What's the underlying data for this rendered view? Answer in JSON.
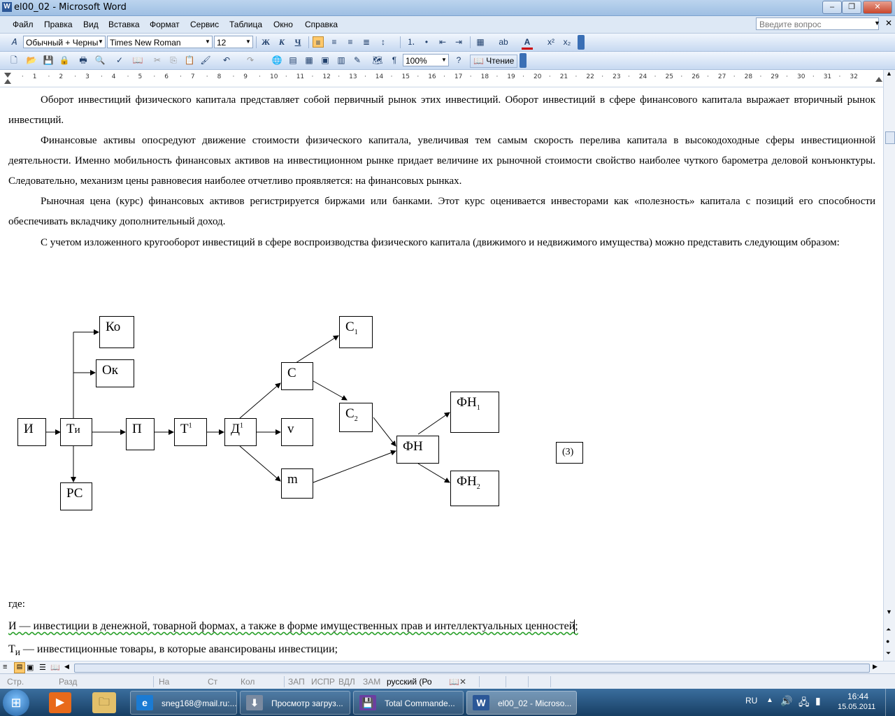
{
  "window": {
    "title": "el00_02 - Microsoft Word"
  },
  "menu": [
    "Файл",
    "Правка",
    "Вид",
    "Вставка",
    "Формат",
    "Сервис",
    "Таблица",
    "Окно",
    "Справка"
  ],
  "helpbox": {
    "placeholder": "Введите вопрос"
  },
  "formatting": {
    "style": "Обычный + Черны",
    "font": "Times New Roman",
    "size": "12"
  },
  "standard": {
    "zoom": "100%",
    "reading": "Чтение"
  },
  "ruler": {
    "ticks": [
      "1",
      "2",
      "3",
      "4",
      "5",
      "6",
      "7",
      "8",
      "9",
      "10",
      "11",
      "12",
      "13",
      "14",
      "15",
      "16",
      "17",
      "18",
      "19",
      "20",
      "21",
      "22",
      "23",
      "24",
      "25",
      "26",
      "27",
      "28",
      "29",
      "30",
      "31",
      "32"
    ]
  },
  "document": {
    "p1": "Оборот инвестиций физического капитала представляет собой первичный рынок этих инвестиций. Оборот инвестиций в сфере финансового капитала выражает вторичный рынок инвестиций.",
    "p2": "Финансовые активы опосредуют движение стоимости физического капитала, увеличивая тем самым скорость перелива капитала в высокодоходные сферы инвестиционной деятельности. Именно мобильность финансовых активов на инвестиционном рынке придает величине их рыночной стоимости свойство наиболее чуткого барометра деловой конъюнктуры. Следовательно, механизм цены равновесия наиболее отчетливо проявляется: на финансовых рынках.",
    "p3": "Рыночная цена (курс) финансовых активов регистрируется биржами или банками. Этот курс оценивается инвесторами как «полезность» капитала с позиций его способности обеспечивать вкладчику дополнительный доход.",
    "p4": "С учетом изложенного кругооборот инвестиций в сфере воспроизводства физического капитала (движимого и недвижимого имущества) можно представить следующим образом:",
    "where": "где:",
    "def1": "И — инвестиции в денежной,  товарной формах, а также в форме имущественных прав и интеллектуальных ценностей;",
    "def2_sym": "Т",
    "def2_sub": "и",
    "def2": " — инвестиционные товары, в которые авансированы инвестиции;"
  },
  "diagram": {
    "I": "И",
    "Ti": "Т",
    "Ti_sub": "и",
    "Ko": "Ко",
    "Ok": "Ок",
    "RS": "РС",
    "P": "П",
    "T1": "Т",
    "T1_sup": "1",
    "D1": "Д",
    "D1_sup": "1",
    "C": "С",
    "C1": "С",
    "C1_sub": "1",
    "C2": "С",
    "C2_sub": "2",
    "v": "v",
    "m": "m",
    "FN": "ФН",
    "FN1": "ФН",
    "FN1_sub": "1",
    "FN2": "ФН",
    "FN2_sub": "2",
    "eq": "(3)"
  },
  "status": {
    "page": "Стр.",
    "section": "Разд",
    "at": "На",
    "line": "Ст",
    "col": "Кол",
    "rec": "ЗАП",
    "trk": "ИСПР",
    "ext": "ВДЛ",
    "ovr": "ЗАМ",
    "lang": "русский (Ро"
  },
  "taskbar": {
    "items": [
      "sneg168@mail.ru:...",
      "Просмотр загруз...",
      "Total Commande...",
      "el00_02 - Microso..."
    ],
    "lang": "RU",
    "time": "16:44",
    "date": "15.05.2011"
  }
}
